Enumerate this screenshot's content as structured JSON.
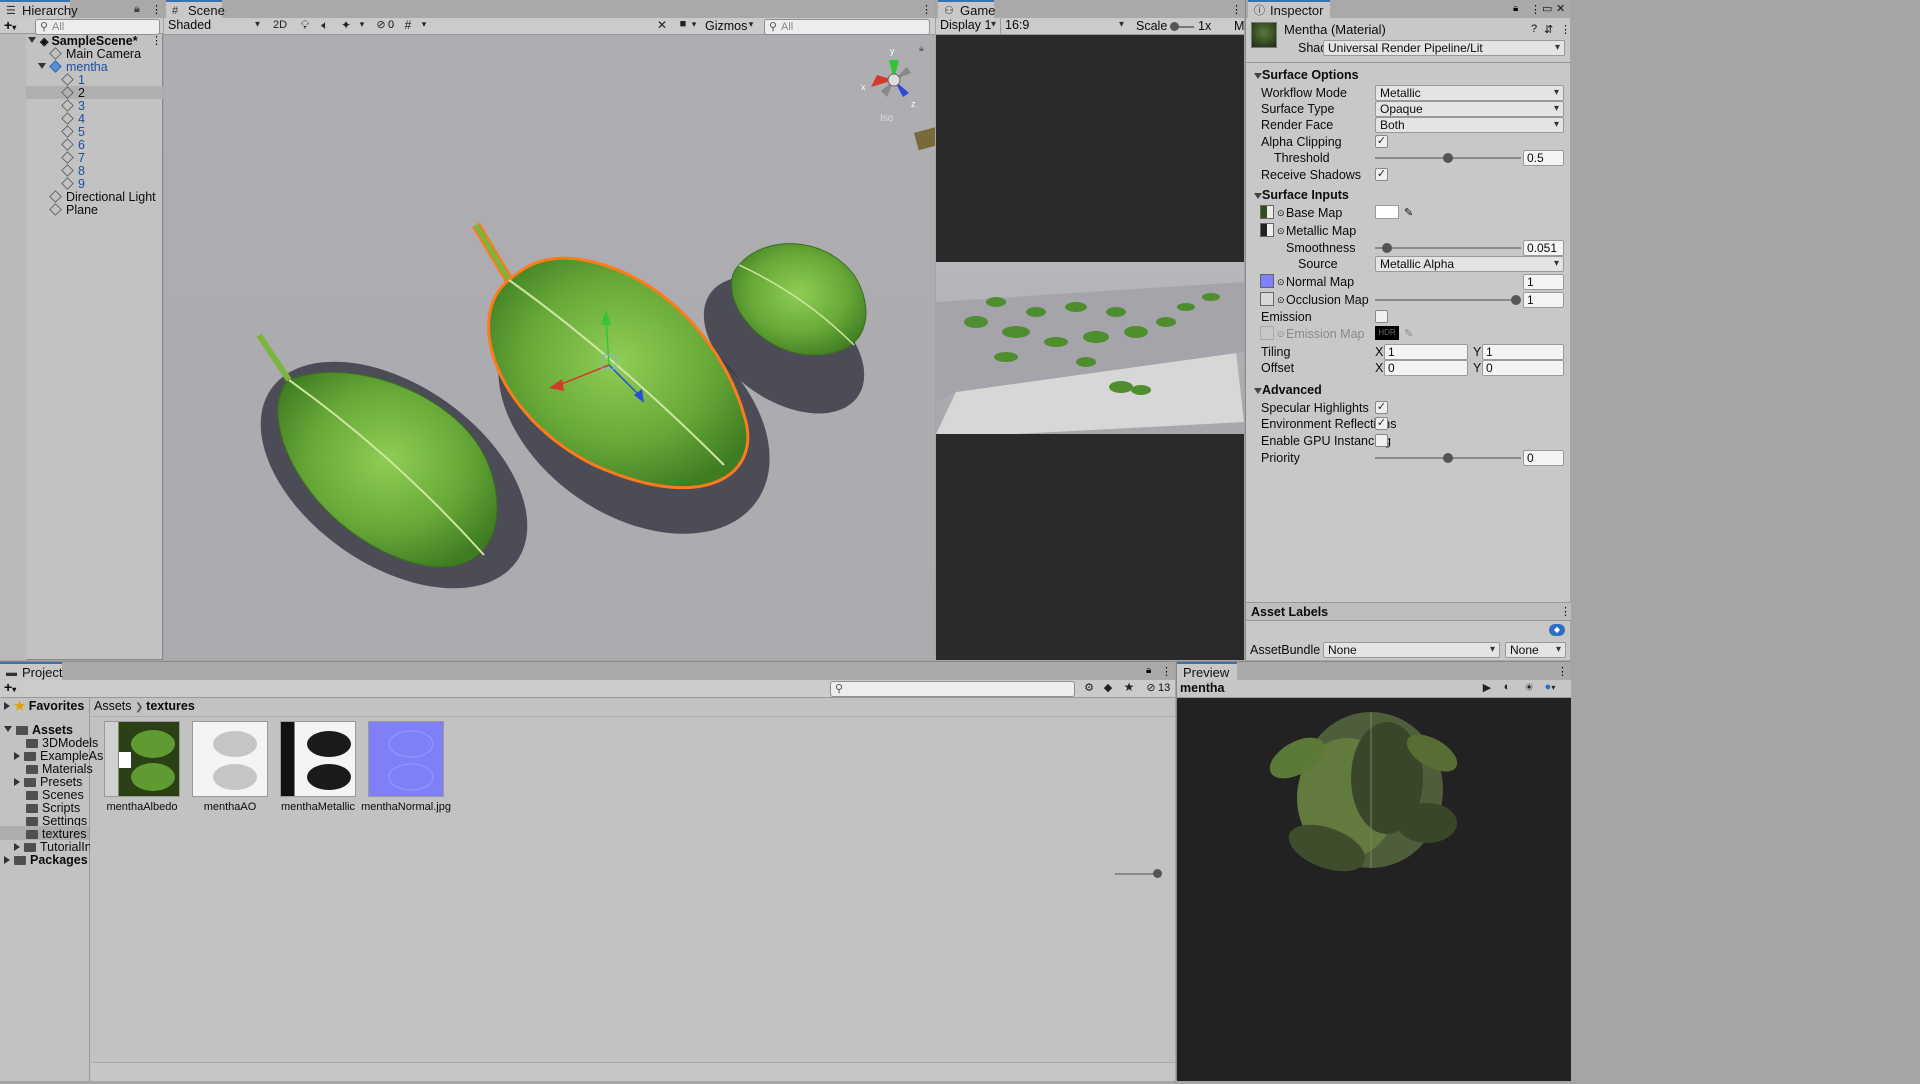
{
  "hierarchy": {
    "tab": "Hierarchy",
    "search_placeholder": "All",
    "scene": "SampleScene*",
    "items": [
      "Main Camera",
      "mentha",
      "1",
      "2",
      "3",
      "4",
      "5",
      "6",
      "7",
      "8",
      "9",
      "Directional Light",
      "Plane"
    ]
  },
  "scene_view": {
    "tab": "Scene",
    "shading": "Shaded",
    "mode_2d": "2D",
    "hidden_count": "0",
    "gizmos": "Gizmos",
    "search_placeholder": "All",
    "persp_label": "Iso",
    "axis_y": "y",
    "axis_x": "x",
    "axis_z": "z"
  },
  "game_view": {
    "tab": "Game",
    "display": "Display 1",
    "aspect": "16:9",
    "scale_label": "Scale",
    "scale_value": "1x",
    "extra": "M"
  },
  "inspector": {
    "tab": "Inspector",
    "title": "Mentha (Material)",
    "shader_label": "Shader",
    "shader": "Universal Render Pipeline/Lit",
    "surface_options": "Surface Options",
    "workflow_mode_label": "Workflow Mode",
    "workflow_mode": "Metallic",
    "surface_type_label": "Surface Type",
    "surface_type": "Opaque",
    "render_face_label": "Render Face",
    "render_face": "Both",
    "alpha_clipping_label": "Alpha Clipping",
    "alpha_clipping": true,
    "threshold_label": "Threshold",
    "threshold": "0.5",
    "threshold_level": 0.5,
    "receive_shadows_label": "Receive Shadows",
    "receive_shadows": true,
    "surface_inputs": "Surface Inputs",
    "base_map_label": "Base Map",
    "metallic_map_label": "Metallic Map",
    "smoothness_label": "Smoothness",
    "smoothness": "0.051",
    "smoothness_level": 0.051,
    "source_label": "Source",
    "source": "Metallic Alpha",
    "normal_map_label": "Normal Map",
    "normal_map_value": "1",
    "occlusion_map_label": "Occlusion Map",
    "occlusion_value": "1",
    "occlusion_level": 1,
    "emission_label": "Emission",
    "emission_map_label": "Emission Map",
    "emission_hdr": "HDR",
    "tiling_label": "Tiling",
    "tiling_x": "1",
    "tiling_y": "1",
    "offset_label": "Offset",
    "offset_x": "0",
    "offset_y": "0",
    "x_label": "X",
    "y_label": "Y",
    "advanced": "Advanced",
    "specular_label": "Specular Highlights",
    "specular": true,
    "env_refl_label": "Environment Reflections",
    "env_refl": true,
    "gpu_inst_label": "Enable GPU Instancing",
    "gpu_inst": false,
    "priority_label": "Priority",
    "priority": "0",
    "priority_level": 0.5,
    "asset_labels": "Asset Labels",
    "assetbundle_label": "AssetBundle",
    "assetbundle": "None",
    "assetbundle_variant": "None"
  },
  "project": {
    "tab": "Project",
    "favorites": "Favorites",
    "assets": "Assets",
    "folders": [
      "3DModels",
      "ExampleAs",
      "Materials",
      "Presets",
      "Scenes",
      "Scripts",
      "Settings",
      "textures",
      "TutorialInfo"
    ],
    "packages": "Packages",
    "breadcrumb_root": "Assets",
    "breadcrumb_current": "textures",
    "hidden_count": "13",
    "files": [
      "menthaAlbedo",
      "menthaAO",
      "menthaMetallic",
      "menthaNormal.jpg"
    ]
  },
  "preview": {
    "tab": "Preview",
    "object": "mentha"
  },
  "colors": {
    "selection_outline": "#ff7a1a",
    "accent": "#3a72b0",
    "leaf": "#6cae3a"
  }
}
